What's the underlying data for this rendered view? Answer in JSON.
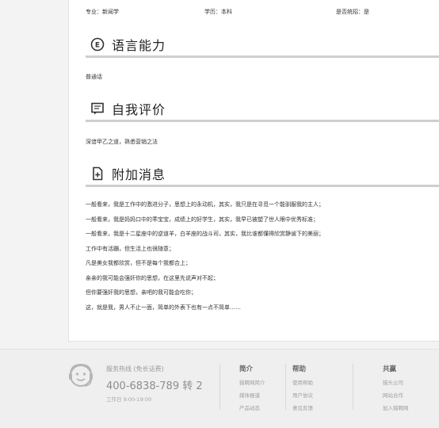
{
  "profile": {
    "major_label": "专业：新闻学",
    "education_label": "学历：本科",
    "overseas_label": "是否统招：是"
  },
  "sections": [
    {
      "title": "语言能力",
      "icon": "e-circle-icon",
      "content": "普通话"
    },
    {
      "title": "自我评价",
      "icon": "chat-bubble-icon",
      "content": "深谙甲乙之道，熟悉营销之法"
    },
    {
      "title": "附加消息",
      "icon": "document-plus-icon"
    }
  ],
  "additional_lines": [
    "一般看来，我是工作中的激进分子，思想上的永动机，其实，我只是在寻觅一个能驯服我的主人；",
    "一般看来，我是妈妈口中的乖宝宝，成绩上的好学生，其实，我早已被塑了世人眼中优秀标准；",
    "一般看来，我是十二星座中的逆道羊，白羊座的战斗司，其实，我比谁都懂得欣赏静谧下的美丽；",
    "工作中有活蹦，但生活上也很随意；",
    "凡是美女我都欣赏，但不是每个我都合上；",
    "亲亲的我可能会强奸你的思想，在这里先说声对不起；",
    "但你要强奸我的思想，亲吧的我可能会吃你；",
    "这，就是我，男人不止一面，简单的外表下也有一点不简单……"
  ],
  "footer": {
    "service_label": "服务热线 (免长话费)",
    "phone": "400-6838-789 转 2",
    "hours": "工作日 9:00-19:00",
    "columns": [
      {
        "title": "简介",
        "links": [
          "猎聘网简介",
          "媒体报道",
          "产品动态"
        ]
      },
      {
        "title": "帮助",
        "links": [
          "使用帮助",
          "用户协议",
          "意见反馈"
        ]
      },
      {
        "title": "共赢",
        "links": [
          "猎头公司",
          "网站合作",
          "加入猎聘网"
        ]
      }
    ]
  }
}
